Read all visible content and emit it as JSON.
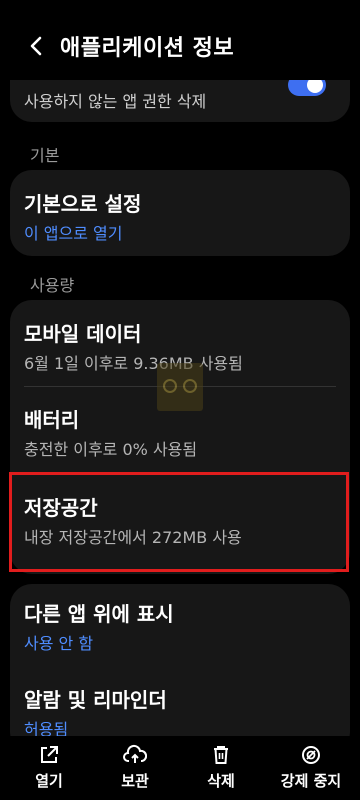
{
  "header": {
    "title": "애플리케이션 정보"
  },
  "top_card": {
    "label": "사용하지 않는 앱 권한 삭제",
    "toggle_on": true
  },
  "sections": {
    "basic": "기본",
    "usage": "사용량"
  },
  "basic_card": {
    "title": "기본으로 설정",
    "subtitle": "이 앱으로 열기"
  },
  "usage_card": {
    "mobile_data": {
      "title": "모바일 데이터",
      "subtitle": "6월 1일 이후로 9.36MB 사용됨"
    },
    "battery": {
      "title": "배터리",
      "subtitle": "충전한 이후로 0% 사용됨"
    },
    "storage": {
      "title": "저장공간",
      "subtitle": "내장 저장공간에서 272MB 사용"
    }
  },
  "other_card": {
    "overlay": {
      "title": "다른 앱 위에 표시",
      "subtitle": "사용 안 함"
    },
    "alarm": {
      "title": "알람 및 리마인더",
      "subtitle": "허용됨"
    }
  },
  "bottom_bar": {
    "open": "열기",
    "archive": "보관",
    "delete": "삭제",
    "force_stop": "강제 중지"
  },
  "colors": {
    "accent": "#4f8dff",
    "toggle": "#3e6ff1",
    "highlight": "#e11d1d",
    "card": "#171717"
  }
}
